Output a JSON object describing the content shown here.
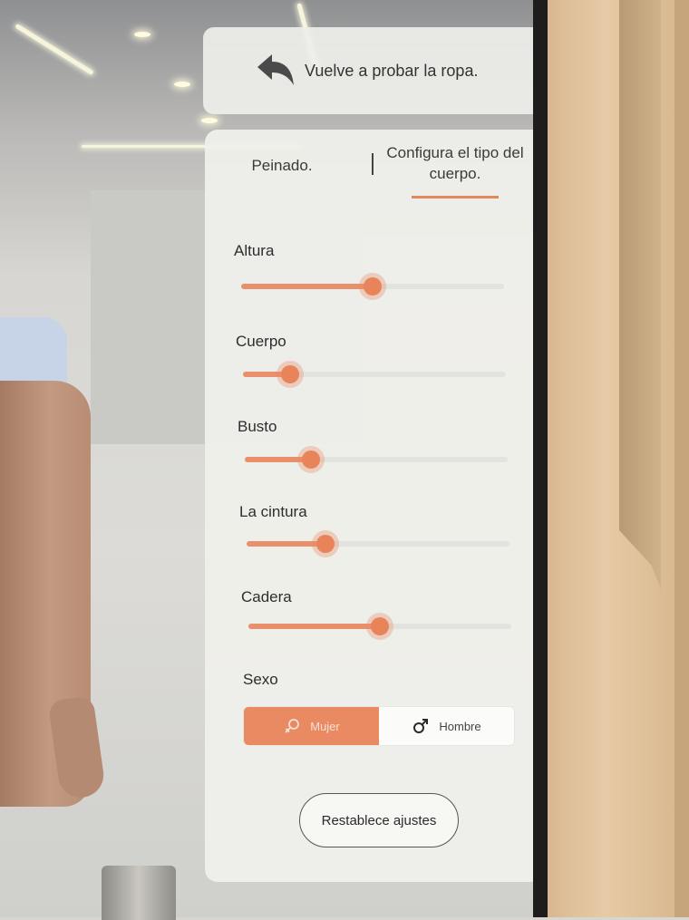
{
  "header": {
    "back_label": "Vuelve a probar la ropa."
  },
  "tabs": [
    {
      "label": "Peinado."
    },
    {
      "label_line1": "Configura el tipo del",
      "label_line2": "cuerpo."
    }
  ],
  "sliders": [
    {
      "label": "Altura",
      "value": 0.5
    },
    {
      "label": "Cuerpo",
      "value": 0.18
    },
    {
      "label": "Busto",
      "value": 0.25
    },
    {
      "label": "La cintura",
      "value": 0.3
    },
    {
      "label": "Cadera",
      "value": 0.5
    }
  ],
  "gender": {
    "label": "Sexo",
    "options": [
      {
        "label": "Mujer",
        "icon": "female-symbol-icon",
        "selected": true
      },
      {
        "label": "Hombre",
        "icon": "male-symbol-icon",
        "selected": false
      }
    ]
  },
  "reset_label": "Restablece ajustes",
  "colors": {
    "accent": "#e8835a",
    "track": "#e2e2df"
  }
}
